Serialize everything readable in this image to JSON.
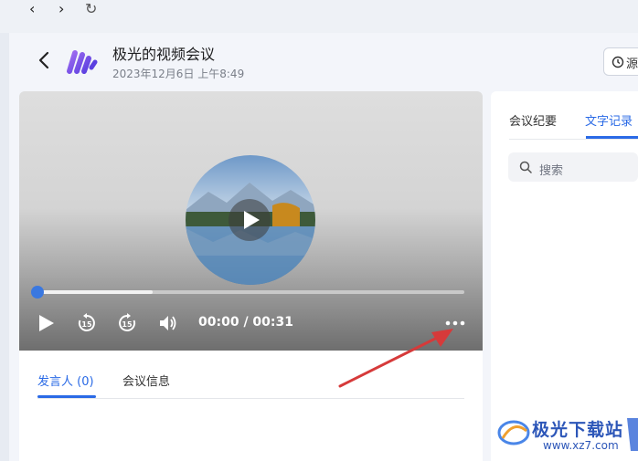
{
  "browser": {
    "back_glyph": "‹",
    "forward_glyph": "›",
    "refresh_glyph": "↻"
  },
  "header": {
    "title": "极光的视频会议",
    "date": "2023年12月6日 上午8:49",
    "top_button_label": "源"
  },
  "player": {
    "time": "00:00 / 00:31",
    "progress_buffered": 0.27,
    "progress_played": 0.0,
    "accent": "#3a78e0"
  },
  "lower_tabs": [
    {
      "label": "发言人 (0)",
      "active": true
    },
    {
      "label": "会议信息",
      "active": false
    }
  ],
  "right_panel": {
    "tabs": [
      {
        "label": "会议纪要",
        "active": false
      },
      {
        "label": "文字记录",
        "active": true
      }
    ],
    "search_placeholder": "搜索"
  },
  "watermark": {
    "text": "极光下载站",
    "url": "www.xz7.com"
  },
  "colors": {
    "active_tab": "#2a6ae6",
    "annotation_arrow": "#d63a3a"
  }
}
